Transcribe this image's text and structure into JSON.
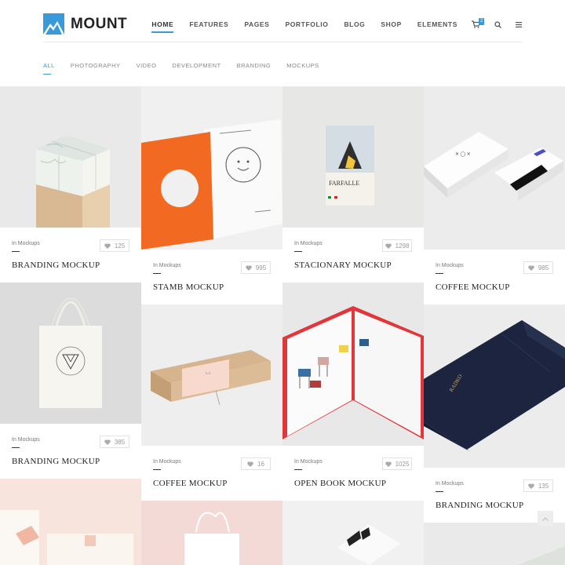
{
  "brand": {
    "name": "MOUNT",
    "accent": "#3a9ad9"
  },
  "nav": {
    "items": [
      "HOME",
      "FEATURES",
      "PAGES",
      "PORTFOLIO",
      "BLOG",
      "SHOP",
      "ELEMENTS"
    ],
    "active": "HOME",
    "cart_count": "2",
    "icons": [
      "cart-icon",
      "search-icon",
      "menu-icon"
    ]
  },
  "filters": {
    "items": [
      "ALL",
      "PHOTOGRAPHY",
      "VIDEO",
      "DEVELOPMENT",
      "BRANDING",
      "MOCKUPS"
    ],
    "active": "ALL"
  },
  "portfolio": [
    {
      "category": "In Mockups",
      "title": "BRANDING MOCKUP",
      "likes": "125"
    },
    {
      "category": "In Mockups",
      "title": "STAMB MOCKUP",
      "likes": "995"
    },
    {
      "category": "In Mockups",
      "title": "STACIONARY MOCKUP",
      "likes": "1298"
    },
    {
      "category": "In Mockups",
      "title": "COFFEE MOCKUP",
      "likes": "985"
    },
    {
      "category": "In Mockups",
      "title": "BRANDING MOCKUP",
      "likes": "385"
    },
    {
      "category": "In Mockups",
      "title": "COFFEE MOCKUP",
      "likes": "16"
    },
    {
      "category": "In Mockups",
      "title": "OPEN BOOK MOCKUP",
      "likes": "1025"
    },
    {
      "category": "In Mockups",
      "title": "BRANDING MOCKUP",
      "likes": "135"
    }
  ],
  "image_text": {
    "farfalle": "FARFALLE",
    "radko": "RADKO"
  }
}
